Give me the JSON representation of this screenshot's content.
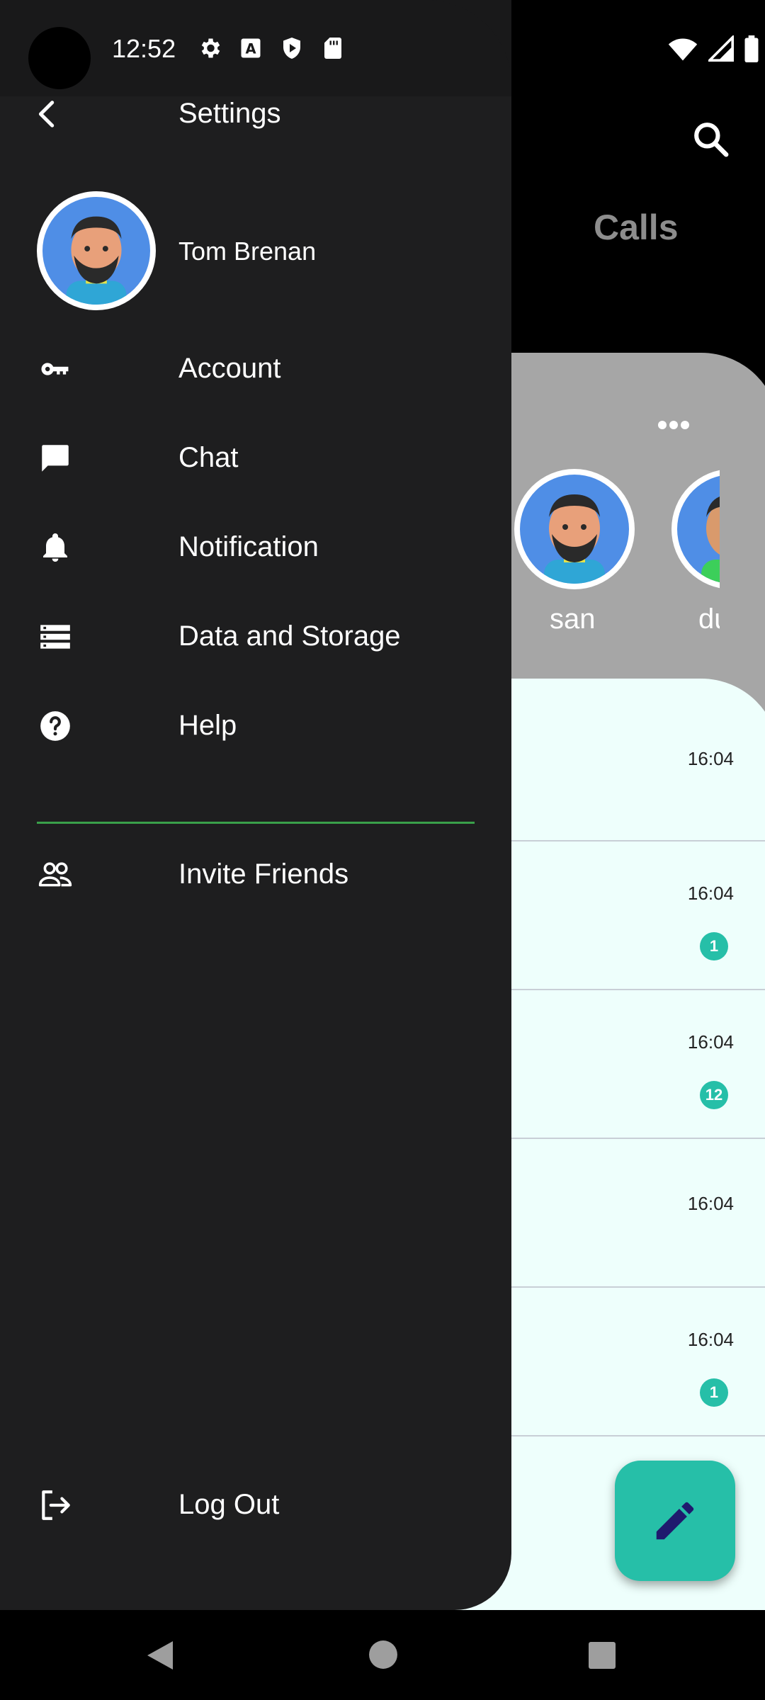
{
  "status_bar": {
    "time": "12:52"
  },
  "drawer": {
    "title": "Settings",
    "profile": {
      "name": "Tom Brenan"
    },
    "menu": [
      {
        "label": "Account",
        "icon": "key-icon"
      },
      {
        "label": "Chat",
        "icon": "chat-bubble-icon"
      },
      {
        "label": "Notification",
        "icon": "bell-icon"
      },
      {
        "label": "Data and Storage",
        "icon": "storage-icon"
      },
      {
        "label": "Help",
        "icon": "help-icon"
      }
    ],
    "invite": {
      "label": "Invite Friends",
      "icon": "people-icon"
    },
    "logout": {
      "label": "Log Out",
      "icon": "logout-icon"
    }
  },
  "background_app": {
    "title": "Calls",
    "stories": [
      {
        "name": "san"
      },
      {
        "name": "du"
      }
    ],
    "chats": [
      {
        "time": "16:04",
        "badge": ""
      },
      {
        "time": "16:04",
        "badge": "1"
      },
      {
        "time": "16:04",
        "badge": "12"
      },
      {
        "time": "16:04",
        "badge": ""
      },
      {
        "time": "16:04",
        "badge": "1"
      }
    ]
  },
  "colors": {
    "accent": "#26bfa8",
    "divider": "#3aa04a",
    "drawer_bg": "#1e1e1f"
  }
}
